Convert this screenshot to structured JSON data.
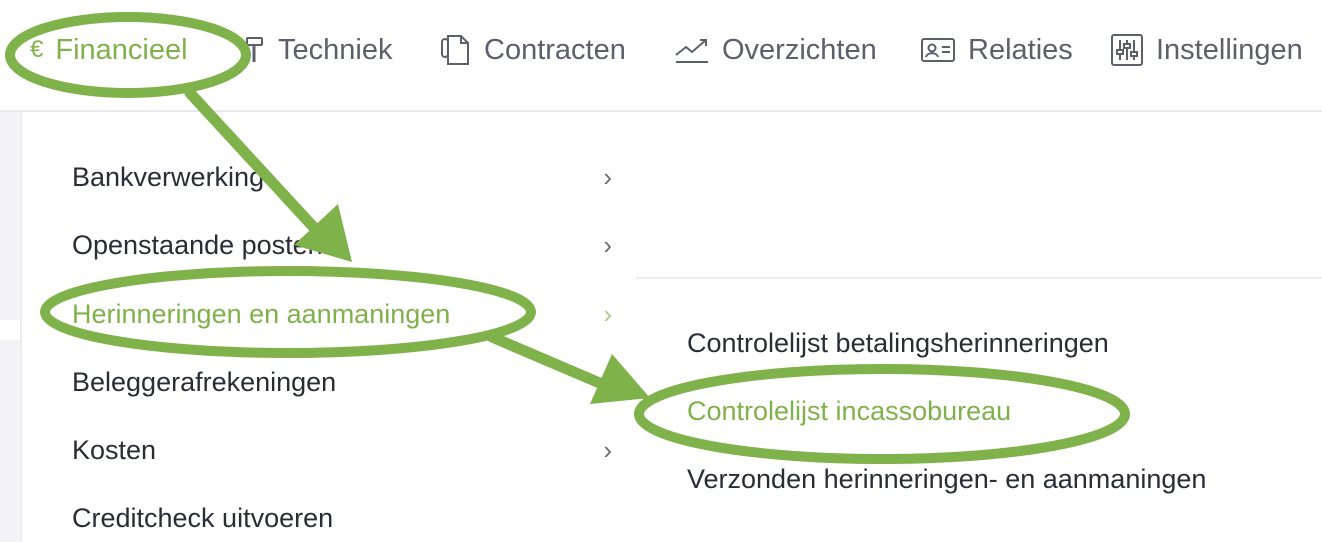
{
  "topnav": {
    "items": [
      {
        "label": "Financieel",
        "icon": "euro-icon",
        "active": true
      },
      {
        "label": "Techniek",
        "icon": "hammer-icon",
        "active": false
      },
      {
        "label": "Contracten",
        "icon": "document-icon",
        "active": false
      },
      {
        "label": "Overzichten",
        "icon": "chart-line-icon",
        "active": false
      },
      {
        "label": "Relaties",
        "icon": "id-card-icon",
        "active": false
      },
      {
        "label": "Instellingen",
        "icon": "sliders-icon",
        "active": false
      }
    ],
    "euro_symbol": "€"
  },
  "menu": {
    "items": [
      {
        "label": "Bankverwerking",
        "has_submenu": true,
        "active": false
      },
      {
        "label": "Openstaande posten",
        "has_submenu": true,
        "active": false
      },
      {
        "label": "Herinneringen en aanmaningen",
        "has_submenu": true,
        "active": true
      },
      {
        "label": "Beleggerafrekeningen",
        "has_submenu": false,
        "active": false
      },
      {
        "label": "Kosten",
        "has_submenu": true,
        "active": false
      },
      {
        "label": "Creditcheck uitvoeren",
        "has_submenu": false,
        "active": false
      }
    ],
    "chevron": "›"
  },
  "submenu": {
    "items": [
      {
        "label": "Controlelijst betalingsherinneringen",
        "active": false
      },
      {
        "label": "Controlelijst incassobureau",
        "active": true
      },
      {
        "label": "Verzonden herinneringen- en aanmaningen",
        "active": false
      }
    ]
  },
  "colors": {
    "accent": "#7fb24a",
    "annotation": "#7fb24a",
    "text": "#2a2c38",
    "nav_text": "#5d5f6d"
  }
}
